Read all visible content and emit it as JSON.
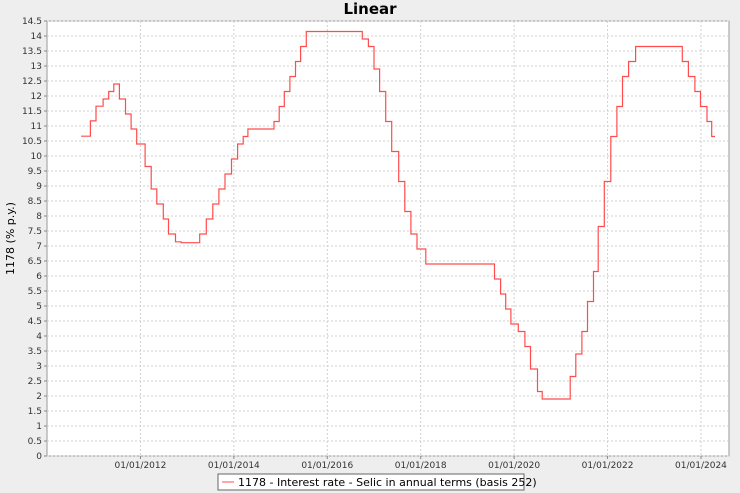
{
  "chart_data": {
    "type": "line",
    "title": "Linear",
    "ylabel": "1178 (% p.y.)",
    "xlabel": "",
    "ylim": [
      0,
      14.5
    ],
    "y_ticks": [
      0,
      0.5,
      1,
      1.5,
      2,
      2.5,
      3,
      3.5,
      4,
      4.5,
      5,
      5.5,
      6,
      6.5,
      7,
      7.5,
      8,
      8.5,
      9,
      9.5,
      10,
      10.5,
      11,
      11.5,
      12,
      12.5,
      13,
      13.5,
      14,
      14.5
    ],
    "y_tick_labels": [
      "0",
      "0.5",
      "1",
      "1.5",
      "2",
      "2.5",
      "3",
      "3.5",
      "4",
      "4.5",
      "5",
      "5.5",
      "6",
      "6.5",
      "7",
      "7.5",
      "8",
      "8.5",
      "9",
      "9.5",
      "10",
      "10.5",
      "11",
      "11.5",
      "12",
      "12.5",
      "13",
      "13.5",
      "14",
      "14.5"
    ],
    "x_tick_labels": [
      "01/01/2012",
      "01/01/2014",
      "01/01/2016",
      "01/01/2018",
      "01/01/2020",
      "01/01/2022",
      "01/01/2024"
    ],
    "x_tick_years": [
      2012,
      2014,
      2016,
      2018,
      2020,
      2022,
      2024
    ],
    "xlim": [
      2010.0,
      2024.6
    ],
    "grid": true,
    "legend_position": "bottom",
    "step": true,
    "series": [
      {
        "name": "1178 - Interest rate - Selic in annual terms (basis 252)",
        "color": "#ff4d4d",
        "x": [
          2010.73,
          2010.93,
          2011.05,
          2011.2,
          2011.32,
          2011.43,
          2011.55,
          2011.68,
          2011.8,
          2011.92,
          2012.1,
          2012.23,
          2012.35,
          2012.49,
          2012.6,
          2012.75,
          2012.87,
          2013.27,
          2013.41,
          2013.55,
          2013.68,
          2013.81,
          2013.95,
          2014.08,
          2014.2,
          2014.3,
          2014.86,
          2014.97,
          2015.08,
          2015.2,
          2015.32,
          2015.43,
          2015.55,
          2016.75,
          2016.88,
          2017.0,
          2017.12,
          2017.25,
          2017.38,
          2017.53,
          2017.66,
          2017.79,
          2017.92,
          2018.11,
          2019.58,
          2019.71,
          2019.82,
          2019.93,
          2020.09,
          2020.23,
          2020.35,
          2020.5,
          2020.6,
          2021.2,
          2021.32,
          2021.45,
          2021.57,
          2021.7,
          2021.8,
          2021.93,
          2022.07,
          2022.2,
          2022.32,
          2022.45,
          2022.6,
          2023.6,
          2023.73,
          2023.87,
          2023.99,
          2024.13,
          2024.23,
          2024.3
        ],
        "y": [
          10.66,
          11.17,
          11.66,
          11.9,
          12.15,
          12.4,
          11.9,
          11.4,
          10.9,
          10.4,
          9.65,
          8.9,
          8.4,
          7.9,
          7.4,
          7.14,
          7.11,
          7.4,
          7.9,
          8.4,
          8.9,
          9.4,
          9.9,
          10.4,
          10.65,
          10.9,
          11.15,
          11.65,
          12.15,
          12.65,
          13.15,
          13.65,
          14.15,
          13.9,
          13.65,
          12.9,
          12.15,
          11.15,
          10.15,
          9.15,
          8.15,
          7.4,
          6.9,
          6.4,
          5.9,
          5.4,
          4.9,
          4.4,
          4.15,
          3.65,
          2.9,
          2.15,
          1.9,
          2.65,
          3.4,
          4.15,
          5.15,
          6.15,
          7.65,
          9.15,
          10.65,
          11.65,
          12.65,
          13.15,
          13.65,
          13.15,
          12.65,
          12.15,
          11.65,
          11.15,
          10.65,
          10.65
        ]
      }
    ]
  }
}
